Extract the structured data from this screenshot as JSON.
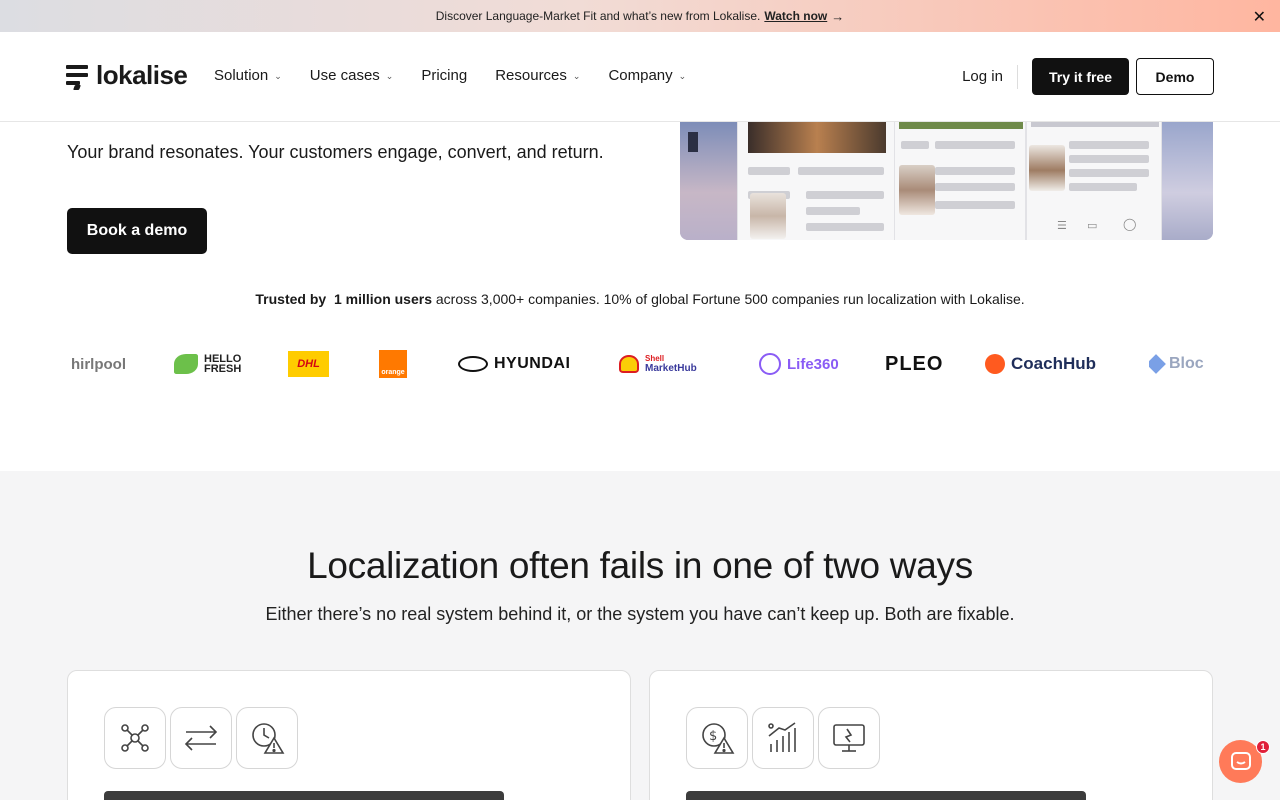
{
  "announcement": {
    "text": "Discover Language-Market Fit and what’s new from Lokalise.",
    "link": "Watch now",
    "arrow": "→",
    "close": "✕"
  },
  "header": {
    "logo_text": "lokalise",
    "nav": [
      {
        "label": "Solution",
        "has_dropdown": true
      },
      {
        "label": "Use cases",
        "has_dropdown": true
      },
      {
        "label": "Pricing",
        "has_dropdown": false
      },
      {
        "label": "Resources",
        "has_dropdown": true
      },
      {
        "label": "Company",
        "has_dropdown": true
      }
    ],
    "login": "Log in",
    "try_free": "Try it free",
    "demo": "Demo"
  },
  "hero": {
    "subtitle": "Your brand resonates. Your customers engage, convert, and return.",
    "cta": "Book a demo"
  },
  "trusted": {
    "prefix": "Trusted by",
    "highlight": "1 million users",
    "suffix": "across 3,000+ companies. 10% of global Fortune 500 companies run localization with Lokalise."
  },
  "logos": [
    {
      "name": "Whirlpool",
      "text": "hirlpool"
    },
    {
      "name": "HelloFresh",
      "line1": "HELLO",
      "line2": "FRESH"
    },
    {
      "name": "DHL",
      "text": "DHL"
    },
    {
      "name": "Orange",
      "text": "orange"
    },
    {
      "name": "Hyundai",
      "text": "HYUNDAI"
    },
    {
      "name": "Shell MarketHub",
      "line1": "Shell",
      "line2": "MarketHub"
    },
    {
      "name": "Life360",
      "text": "Life360"
    },
    {
      "name": "Pleo",
      "text": "PLEO"
    },
    {
      "name": "CoachHub",
      "text": "CoachHub"
    },
    {
      "name": "Bloc",
      "text": "Bloc"
    }
  ],
  "section2": {
    "title": "Localization often fails in one of two ways",
    "subtitle": "Either there’s no real system behind it, or the system you have can’t keep up. Both are fixable."
  },
  "cards": [
    {
      "icons": [
        "network-icon",
        "arrows-swap-icon",
        "clock-warning-icon"
      ]
    },
    {
      "icons": [
        "dollar-warning-icon",
        "growth-chart-icon",
        "monitor-broken-icon"
      ]
    }
  ],
  "chat": {
    "badge": "1"
  },
  "colors": {
    "dark": "#111111",
    "section_bg": "#f5f5f6",
    "chat": "#ff7a59",
    "badge": "#e0203a"
  }
}
